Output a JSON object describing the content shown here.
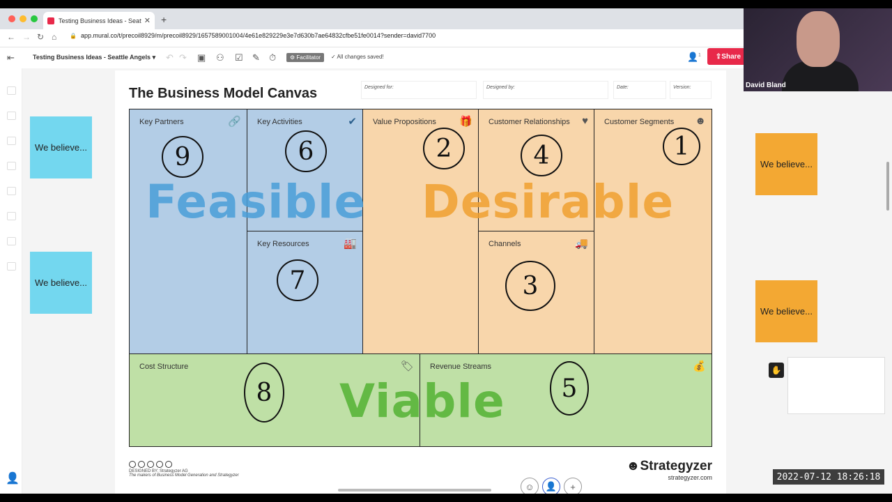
{
  "browser": {
    "tab_title": "Testing Business Ideas - Seattl",
    "url": "app.mural.co/t/precoil8929/m/precoil8929/1657589001004/4e61e829229e3e7d630b7ae64832cfbe51fe0014?sender=david7700"
  },
  "toolbar": {
    "board_title": "Testing Business Ideas - Seattle Angels",
    "facilitator": "Facilitator",
    "saved_status": "All changes saved!",
    "share_label": "Share",
    "user_count": "1"
  },
  "canvas": {
    "title": "The Business Model Canvas",
    "meta": {
      "designed_for": "Designed for:",
      "designed_by": "Designed by:",
      "date": "Date:",
      "version": "Version:"
    },
    "blocks": {
      "key_partners": {
        "label": "Key Partners",
        "number": "9"
      },
      "key_activities": {
        "label": "Key Activities",
        "number": "6"
      },
      "key_resources": {
        "label": "Key Resources",
        "number": "7"
      },
      "value_propositions": {
        "label": "Value Propositions",
        "number": "2"
      },
      "customer_relationships": {
        "label": "Customer Relationships",
        "number": "4"
      },
      "channels": {
        "label": "Channels",
        "number": "3"
      },
      "customer_segments": {
        "label": "Customer Segments",
        "number": "1"
      },
      "cost_structure": {
        "label": "Cost Structure",
        "number": "8"
      },
      "revenue_streams": {
        "label": "Revenue Streams",
        "number": "5"
      }
    },
    "overlays": {
      "feasible": "Feasible",
      "desirable": "Desirable",
      "viable": "Viable"
    },
    "colors": {
      "feasible": "#4a9fd8",
      "desirable": "#f0a030",
      "viable": "#5ab53a"
    },
    "footer": {
      "designed_by": "DESIGNED BY: Strategyzer AG",
      "makers": "The makers of Business Model Generation and Strategyzer",
      "brand": "Strategyzer",
      "site": "strategyzer.com"
    }
  },
  "stickies": {
    "left_1": "We believe...",
    "left_2": "We believe...",
    "right_1": "We believe...",
    "right_2": "We believe..."
  },
  "video": {
    "name": "David Bland"
  },
  "timestamp": "2022-07-12  18:26:18"
}
